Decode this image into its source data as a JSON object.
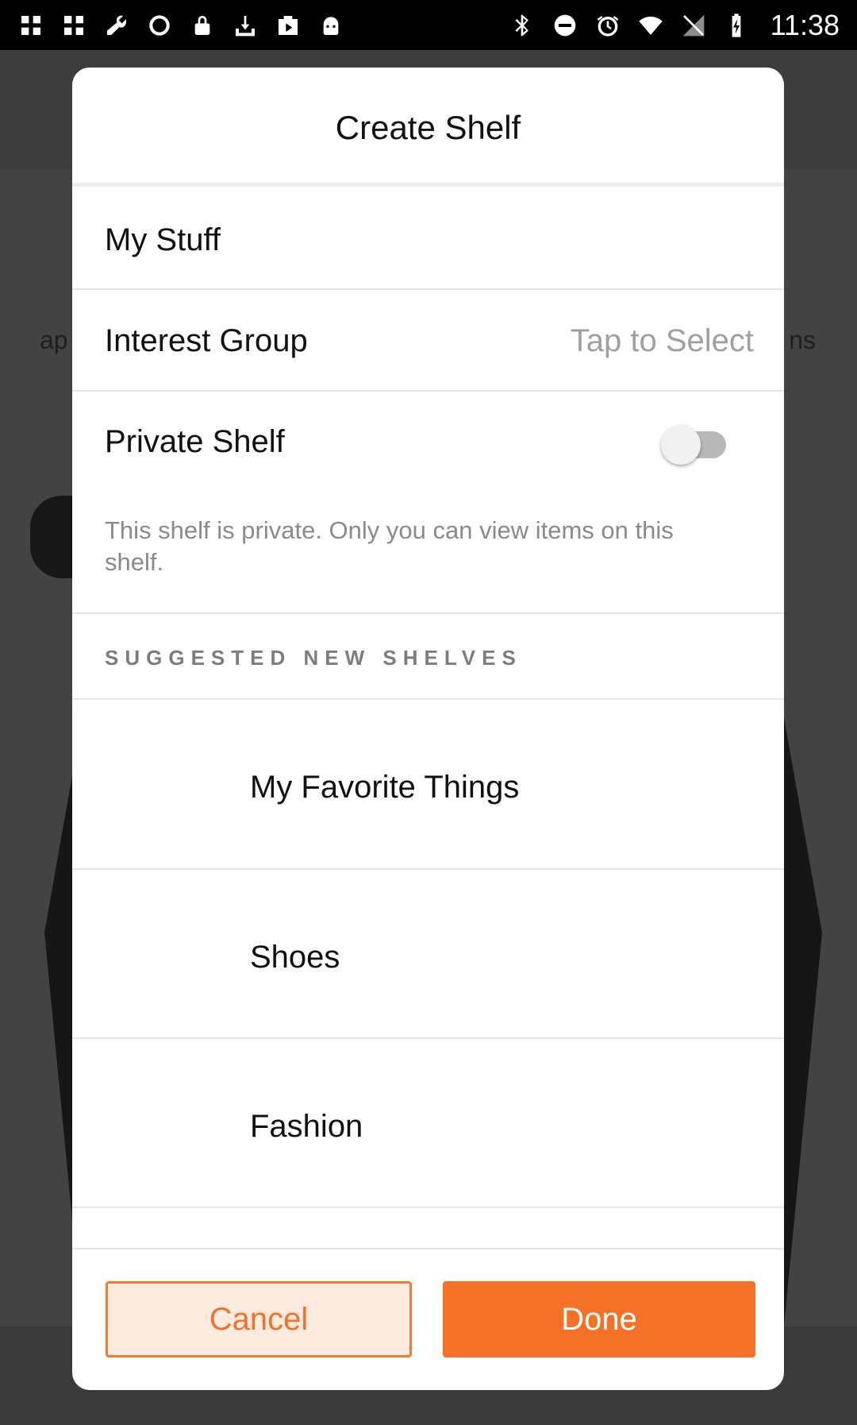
{
  "status_bar": {
    "time": "11:38",
    "left_icons": [
      "grid-icon",
      "grid-icon",
      "wrench-icon",
      "circle-icon",
      "lock-icon",
      "download-tray-icon",
      "play-store-icon",
      "android-icon"
    ],
    "right_icons": [
      "bluetooth-icon",
      "do-not-disturb-icon",
      "alarm-icon",
      "wifi-icon",
      "no-signal-icon",
      "battery-charging-icon"
    ]
  },
  "background": {
    "left_text": "ap",
    "right_text": "ns"
  },
  "modal": {
    "title": "Create Shelf",
    "name_field": {
      "value": "My Stuff"
    },
    "interest_group": {
      "label": "Interest Group",
      "placeholder": "Tap to Select"
    },
    "private_shelf": {
      "label": "Private Shelf",
      "enabled": false
    },
    "private_helper": "This shelf is private. Only you can view items on this shelf.",
    "suggested_title": "SUGGESTED NEW SHELVES",
    "suggestions": [
      {
        "label": "My Favorite Things"
      },
      {
        "label": "Shoes"
      },
      {
        "label": "Fashion"
      }
    ],
    "buttons": {
      "cancel": "Cancel",
      "done": "Done"
    }
  },
  "colors": {
    "accent": "#f47227",
    "accent_light": "#fdebe0",
    "status_bar": "#000000"
  }
}
